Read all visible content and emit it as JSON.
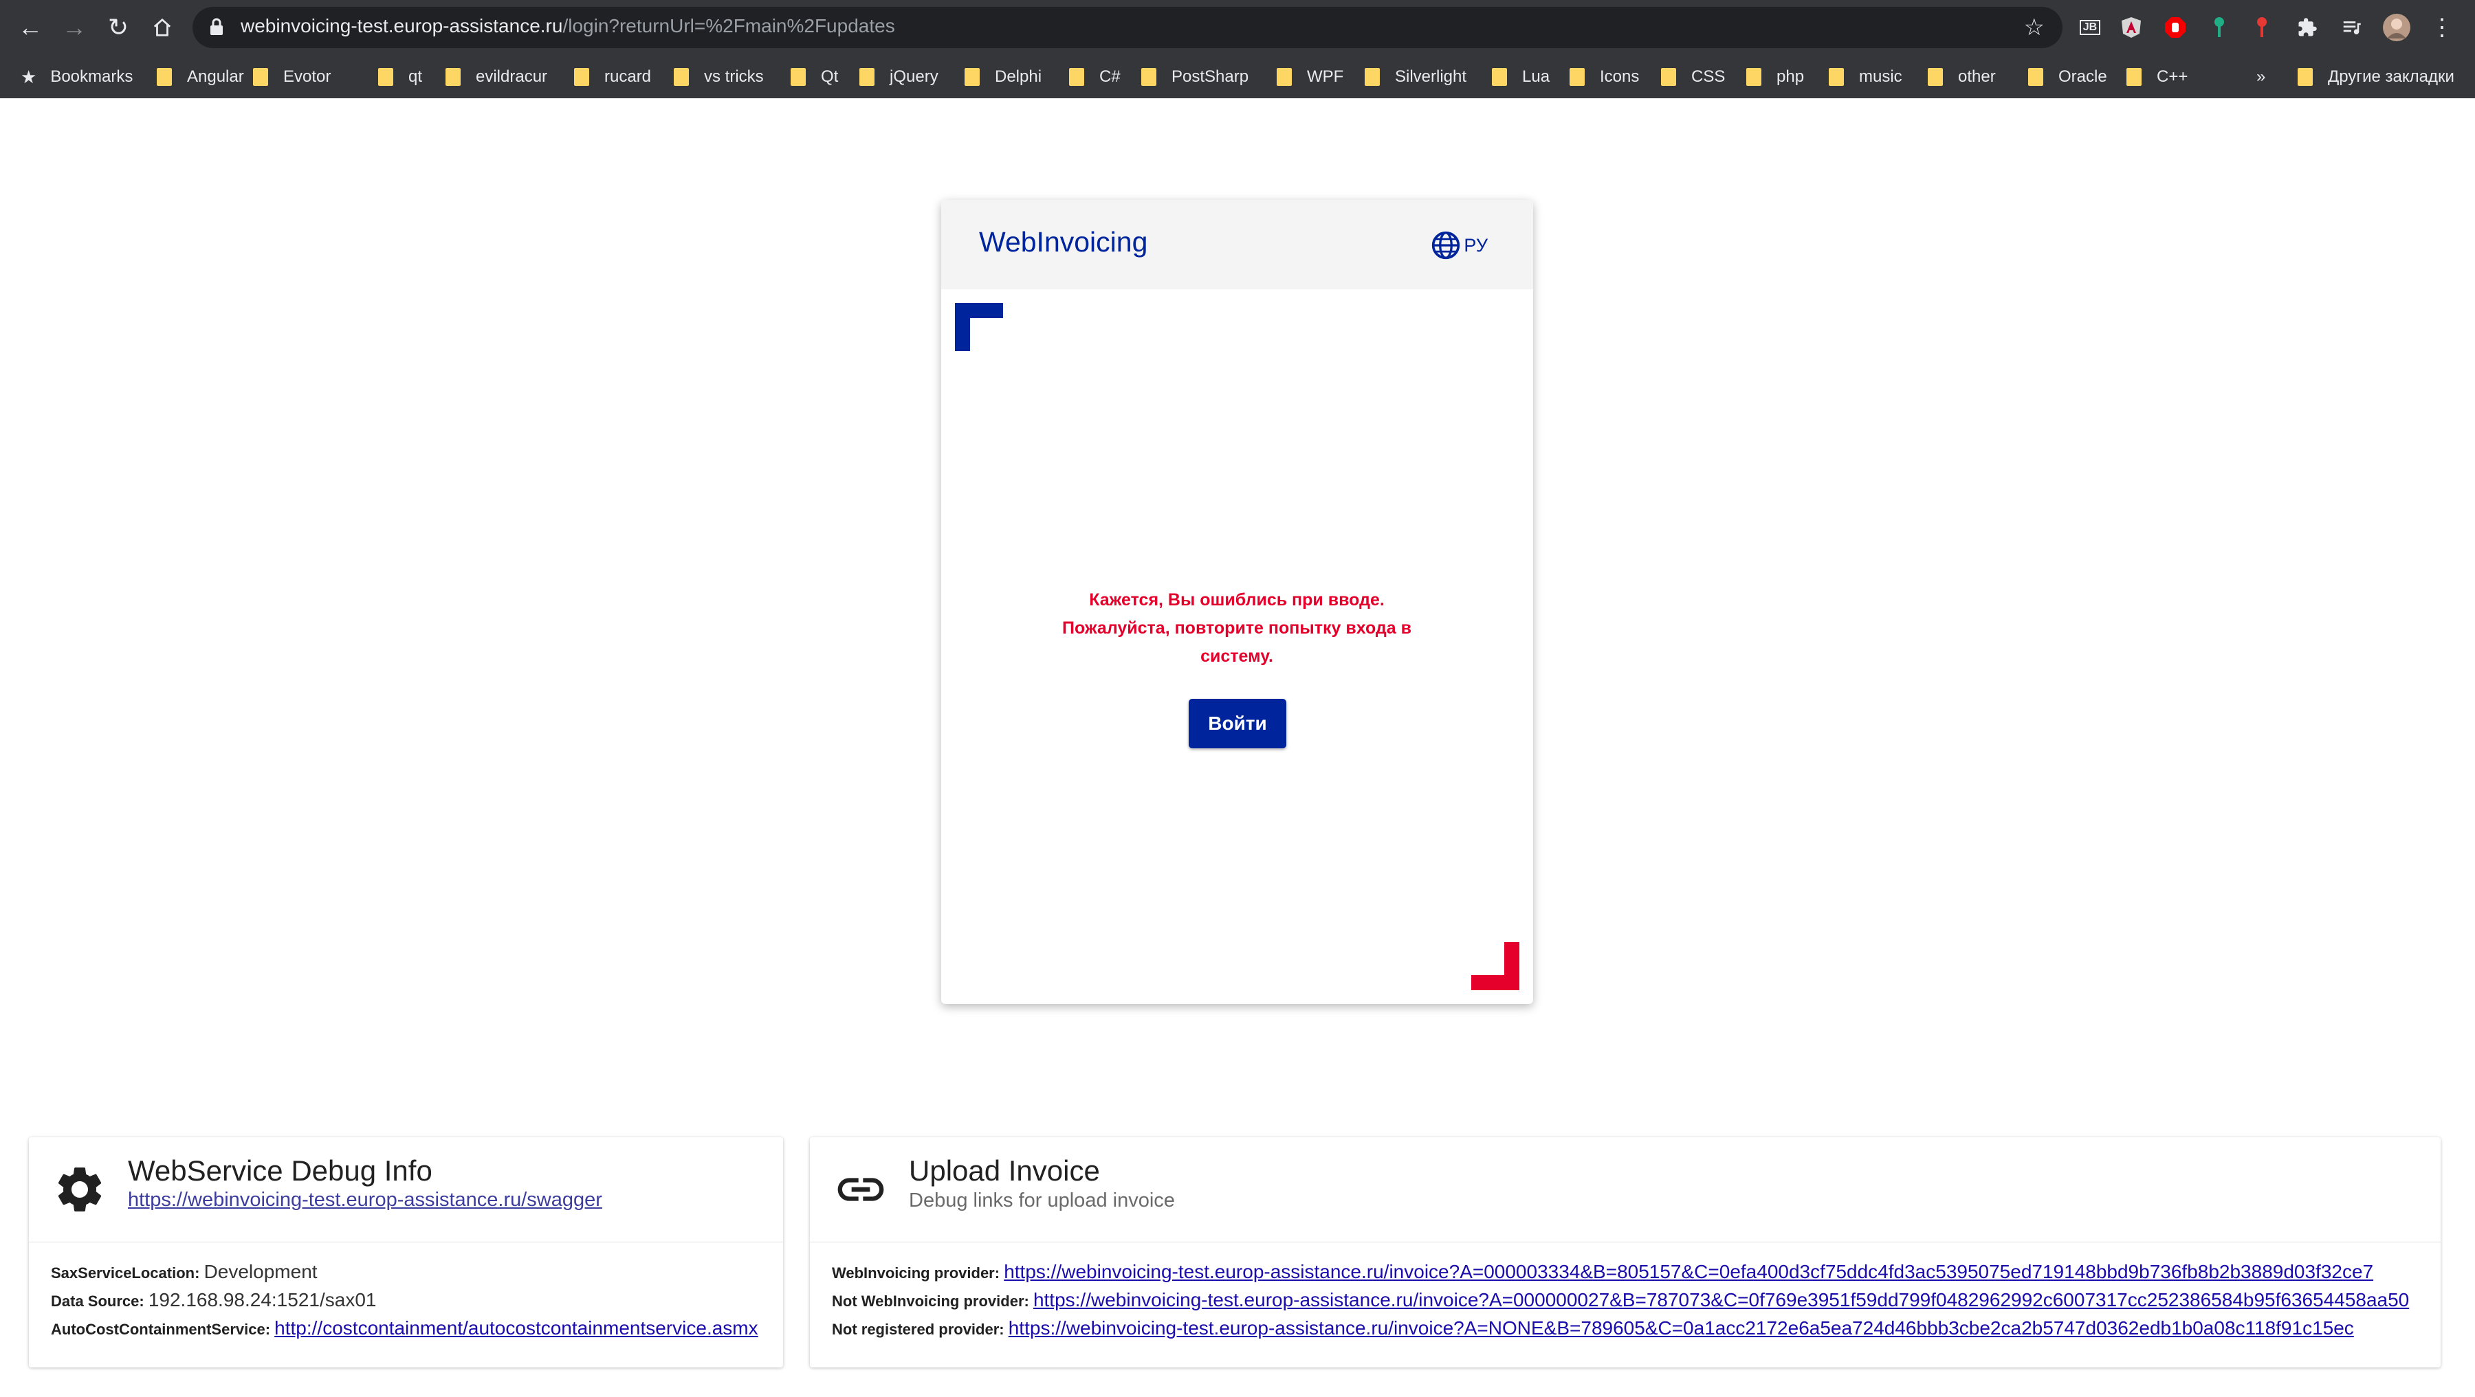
{
  "browser": {
    "url_host": "webinvoicing-test.europ-assistance.ru",
    "url_path": "/login?returnUrl=%2Fmain%2Fupdates",
    "bookmarks": [
      {
        "label": "Bookmarks",
        "icon": "star-icon"
      },
      {
        "label": "Angular"
      },
      {
        "label": "Evotor"
      },
      {
        "label": "qt"
      },
      {
        "label": "evildracur"
      },
      {
        "label": "rucard"
      },
      {
        "label": "vs tricks"
      },
      {
        "label": "Qt"
      },
      {
        "label": "jQuery"
      },
      {
        "label": "Delphi"
      },
      {
        "label": "C#"
      },
      {
        "label": "PostSharp"
      },
      {
        "label": "WPF"
      },
      {
        "label": "Silverlight"
      },
      {
        "label": "Lua"
      },
      {
        "label": "Icons"
      },
      {
        "label": "CSS"
      },
      {
        "label": "php"
      },
      {
        "label": "music"
      },
      {
        "label": "other"
      },
      {
        "label": "Oracle"
      },
      {
        "label": "C++"
      }
    ],
    "overflow_label": "»",
    "other_bookmarks": "Другие закладки",
    "extensions": [
      "jetbrains-icon",
      "angular-icon",
      "adblock-icon",
      "key-green-icon",
      "key-red-icon",
      "puzzle-icon",
      "media-queue-icon",
      "profile-avatar-icon"
    ]
  },
  "login": {
    "brand": "WebInvoicing",
    "lang": "РУ",
    "error_lines": [
      "Кажется, Вы ошиблись при вводе.",
      "Пожалуйста, повторите попытку входа в",
      "систему."
    ],
    "button": "Войти",
    "colors": {
      "primary": "#00249c",
      "accent": "#e4002b"
    }
  },
  "debug": {
    "title": "WebService Debug Info",
    "link": "https://webinvoicing-test.europ-assistance.ru/swagger",
    "rows": {
      "sax_label": "SaxServiceLocation:",
      "sax_value": "Development",
      "ds_label": "Data Source:",
      "ds_value": "192.168.98.24:1521/sax01",
      "acc_label": "AutoCostContainmentService:",
      "acc_value": "http://costcontainment/autocostcontainmentservice.asmx"
    }
  },
  "upload": {
    "title": "Upload Invoice",
    "subtitle": "Debug links for upload invoice",
    "rows": {
      "wi_label": "WebInvoicing provider:",
      "wi_value": "https://webinvoicing-test.europ-assistance.ru/invoice?A=000003334&B=805157&C=0efa400d3cf75ddc4fd3ac5395075ed719148bbd9b736fb8b2b3889d03f32ce7",
      "nwi_label": "Not WebInvoicing provider:",
      "nwi_value": "https://webinvoicing-test.europ-assistance.ru/invoice?A=000000027&B=787073&C=0f769e3951f59dd799f0482962992c6007317cc252386584b95f63654458aa50",
      "nr_label": "Not registered provider:",
      "nr_value": "https://webinvoicing-test.europ-assistance.ru/invoice?A=NONE&B=789605&C=0a1acc2172e6a5ea724d46bbb3cbe2ca2b5747d0362edb1b0a08c118f91c15ec"
    }
  }
}
